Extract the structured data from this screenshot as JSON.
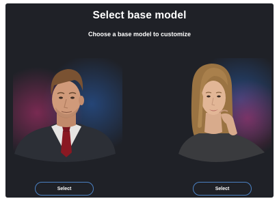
{
  "header": {
    "title": "Select base model",
    "subtitle": "Choose a base model to customize"
  },
  "models": [
    {
      "id": "male",
      "select_label": "Select"
    },
    {
      "id": "female",
      "select_label": "Select"
    }
  ],
  "colors": {
    "background": "#1f2127",
    "button_border": "#4b82c4",
    "glow_blue": "#2a63b8",
    "glow_pink": "#b4306e"
  }
}
